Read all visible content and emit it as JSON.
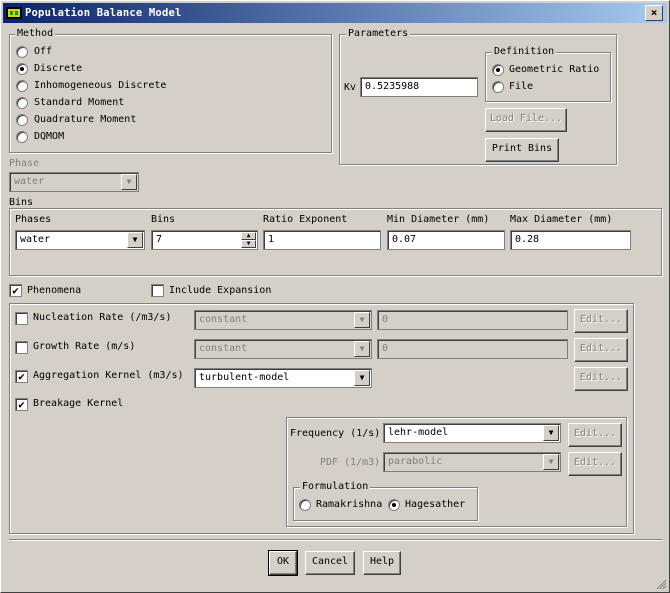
{
  "window": {
    "title": "Population Balance Model",
    "close_symbol": "×"
  },
  "method": {
    "label": "Method",
    "options": [
      {
        "label": "Off",
        "selected": false
      },
      {
        "label": "Discrete",
        "selected": true
      },
      {
        "label": "Inhomogeneous Discrete",
        "selected": false
      },
      {
        "label": "Standard Moment",
        "selected": false
      },
      {
        "label": "Quadrature Moment",
        "selected": false
      },
      {
        "label": "DQMOM",
        "selected": false
      }
    ]
  },
  "parameters": {
    "label": "Parameters",
    "kv_label": "Kv",
    "kv_value": "0.5235988",
    "definition": {
      "label": "Definition",
      "options": [
        {
          "label": "Geometric Ratio",
          "selected": true
        },
        {
          "label": "File",
          "selected": false
        }
      ]
    },
    "load_file_label": "Load File...",
    "print_bins_label": "Print Bins"
  },
  "phase": {
    "label": "Phase",
    "value": "water"
  },
  "bins": {
    "label": "Bins",
    "headers": {
      "phases": "Phases",
      "bins": "Bins",
      "ratio_exponent": "Ratio Exponent",
      "min_diameter": "Min Diameter (mm)",
      "max_diameter": "Max Diameter (mm)"
    },
    "values": {
      "phases": "water",
      "bins": "7",
      "ratio_exponent": "1",
      "min_diameter": "0.07",
      "max_diameter": "0.28"
    }
  },
  "phenomena": {
    "phenomena_label": "Phenomena",
    "phenomena_checked": true,
    "include_expansion_label": "Include Expansion",
    "include_expansion_checked": false,
    "nucleation": {
      "label": "Nucleation Rate (/m3/s)",
      "checked": false,
      "method": "constant",
      "value": "0",
      "edit_label": "Edit..."
    },
    "growth": {
      "label": "Growth Rate (m/s)",
      "checked": false,
      "method": "constant",
      "value": "0",
      "edit_label": "Edit..."
    },
    "aggregation": {
      "label": "Aggregation Kernel (m3/s)",
      "checked": true,
      "method": "turbulent-model",
      "edit_label": "Edit..."
    },
    "breakage": {
      "label": "Breakage Kernel",
      "checked": true,
      "frequency_label": "Frequency (1/s)",
      "frequency_value": "lehr-model",
      "frequency_edit": "Edit...",
      "pdf_label": "PDF (1/m3)",
      "pdf_value": "parabolic",
      "pdf_edit": "Edit...",
      "formulation": {
        "label": "Formulation",
        "options": [
          {
            "label": "Ramakrishna",
            "selected": false
          },
          {
            "label": "Hagesather",
            "selected": true
          }
        ]
      }
    }
  },
  "footer": {
    "ok": "OK",
    "cancel": "Cancel",
    "help": "Help"
  },
  "icons": {
    "check_mark": "✔",
    "dropdown_arrow": "▼",
    "spin_up": "▲",
    "spin_down": "▼"
  }
}
